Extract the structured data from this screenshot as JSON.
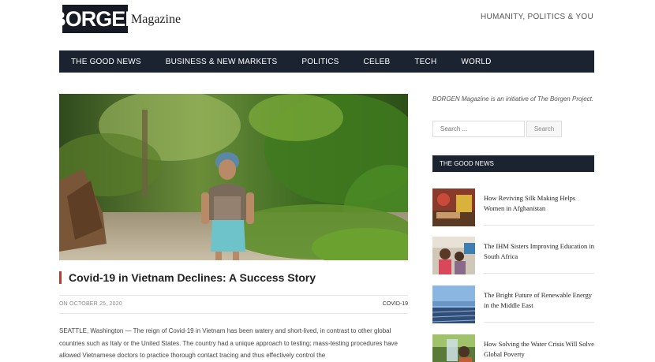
{
  "header": {
    "logo_mark": "BORGEN",
    "logo_word": "Magazine",
    "tagline": "HUMANITY, POLITICS & YOU"
  },
  "nav": {
    "items": [
      "THE GOOD NEWS",
      "BUSINESS & NEW MARKETS",
      "POLITICS",
      "CELEB",
      "TECH",
      "WORLD"
    ]
  },
  "article": {
    "title": "Covid-19 in Vietnam Declines: A Success Story",
    "date": "ON OCTOBER 25, 2020",
    "category": "COVID-19",
    "body": "SEATTLE, Washington — The reign of Covid-19 in Vietnam has been watery and short-lived, in contrast to other global countries such as Italy or the United States. The country had a unique approach to testing: mass-testing procedures have allowed Vietnamese doctors to practice thorough contact tracing and thus effectively control the"
  },
  "sidebar": {
    "intro_prefix": "BORGEN Magazine is an initiative of ",
    "intro_link": "The Borgen Project",
    "intro_suffix": ".",
    "search_placeholder": "Search ...",
    "search_button": "Search",
    "section_title": "THE GOOD NEWS",
    "items": [
      {
        "title": "How Reviving Silk Making Helps Women in Afghanistan"
      },
      {
        "title": "The IHM Sisters Improving Education in South Africa"
      },
      {
        "title": "The Bright Future of Renewable Energy in the Middle East"
      },
      {
        "title": "How Solving the Water Crisis Will Solve Global Poverty"
      }
    ]
  }
}
